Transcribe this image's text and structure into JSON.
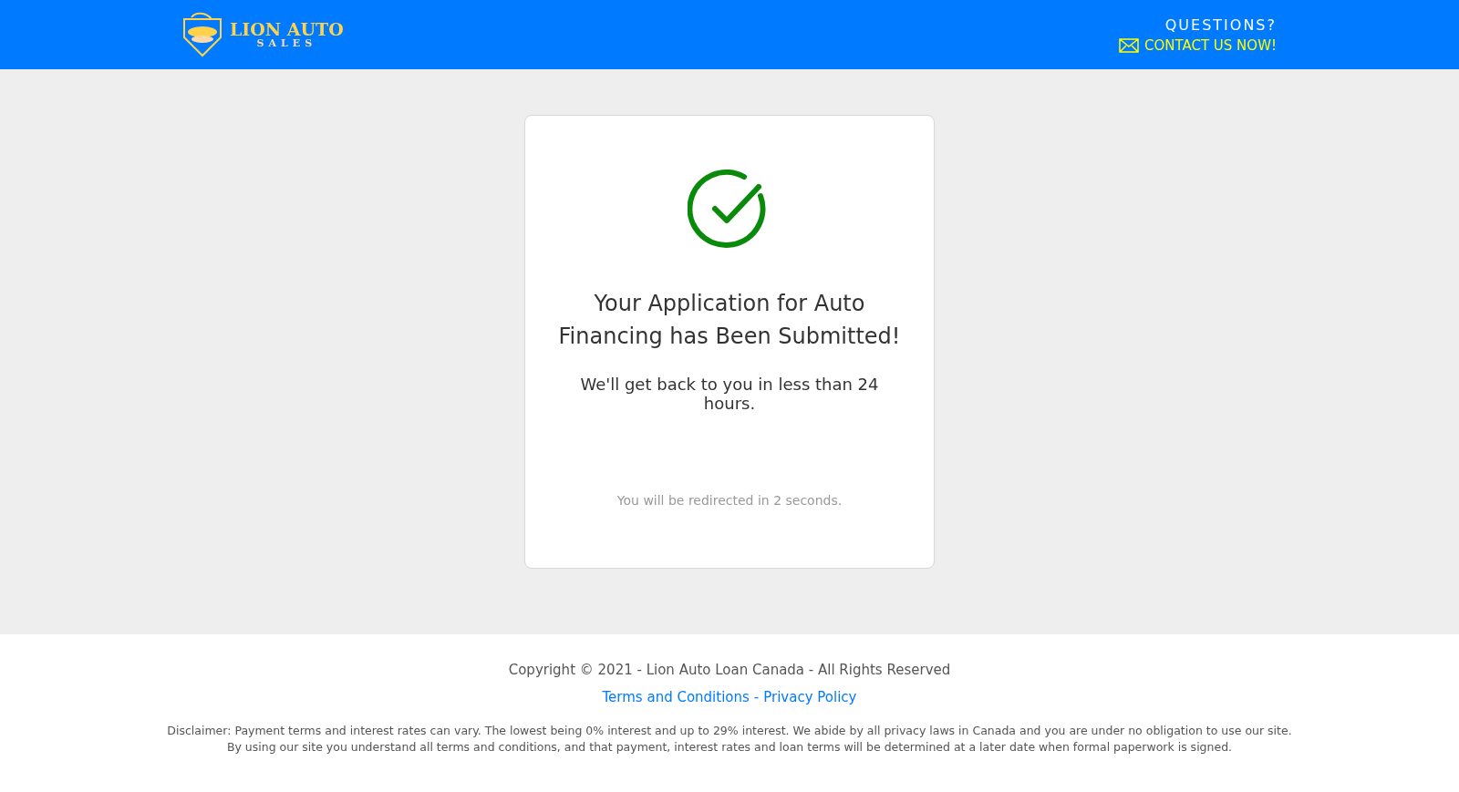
{
  "header": {
    "logo": {
      "title": "LION AUTO",
      "subtitle": "SALES"
    },
    "questions": "QUESTIONS?",
    "contact": "CONTACT US NOW!"
  },
  "card": {
    "title": "Your Application for Auto Financing has Been Submitted!",
    "message": "We'll get back to you in less than 24 hours.",
    "redirect": "You will be redirected in 2 seconds."
  },
  "footer": {
    "copyright": "Copyright © 2021 - Lion Auto Loan Canada - All Rights Reserved",
    "links": [
      "Terms and Conditions",
      "Privacy Policy"
    ],
    "separator": "-",
    "disclaimer": [
      "Disclaimer: Payment terms and interest rates can vary. The lowest being 0% interest and up to 29% interest. We abide by all privacy laws in Canada and you are under no obligation to use our site.",
      "By using our site you understand all terms and conditions, and that payment, interest rates and loan terms will be determined at a later date when formal paperwork is signed."
    ]
  }
}
